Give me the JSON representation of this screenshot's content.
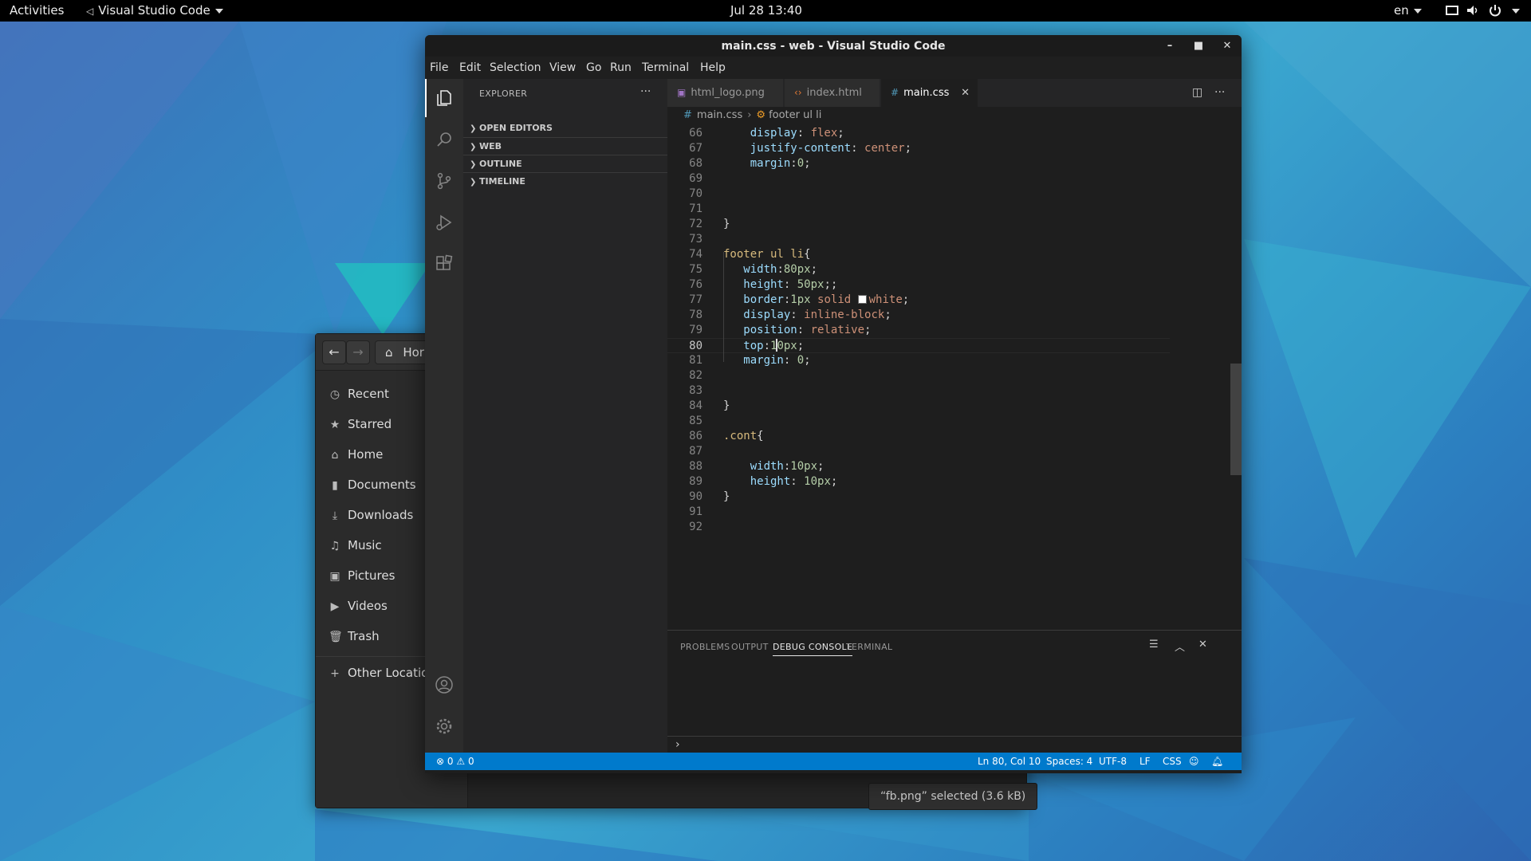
{
  "topbar": {
    "activities": "Activities",
    "app_name": "Visual Studio Code",
    "clock": "Jul 28  13:40",
    "lang": "en"
  },
  "files": {
    "path_label": "Hor",
    "sidebar": [
      {
        "label": "Recent",
        "icon": "clock-icon"
      },
      {
        "label": "Starred",
        "icon": "star-icon"
      },
      {
        "label": "Home",
        "icon": "home-icon"
      },
      {
        "label": "Documents",
        "icon": "document-icon"
      },
      {
        "label": "Downloads",
        "icon": "download-icon"
      },
      {
        "label": "Music",
        "icon": "music-icon"
      },
      {
        "label": "Pictures",
        "icon": "picture-icon"
      },
      {
        "label": "Videos",
        "icon": "video-icon"
      },
      {
        "label": "Trash",
        "icon": "trash-icon"
      },
      {
        "label": "Other Locations",
        "icon": "plus-icon"
      }
    ],
    "status": "“fb.png” selected (3.6 kB)"
  },
  "vscode": {
    "title": "main.css - web - Visual Studio Code",
    "menu": [
      "File",
      "Edit",
      "Selection",
      "View",
      "Go",
      "Run",
      "Terminal",
      "Help"
    ],
    "explorer": {
      "title": "EXPLORER",
      "sections": [
        "OPEN EDITORS",
        "WEB",
        "OUTLINE",
        "TIMELINE"
      ]
    },
    "tabs": [
      {
        "label": "html_logo.png",
        "icon": "image-icon"
      },
      {
        "label": "index.html",
        "icon": "html-icon"
      },
      {
        "label": "main.css",
        "icon": "css-icon",
        "active": true
      }
    ],
    "breadcrumb": {
      "file": "main.css",
      "symbol": "footer ul li"
    },
    "code_lines": [
      {
        "n": "66",
        "parts": [
          [
            "p",
            "    display"
          ],
          [
            "x",
            ": "
          ],
          [
            "v",
            "flex"
          ],
          [
            "x",
            ";"
          ]
        ]
      },
      {
        "n": "67",
        "parts": [
          [
            "p",
            "    justify-content"
          ],
          [
            "x",
            ": "
          ],
          [
            "v",
            "center"
          ],
          [
            "x",
            ";"
          ]
        ]
      },
      {
        "n": "68",
        "parts": [
          [
            "p",
            "    margin"
          ],
          [
            "x",
            ":"
          ],
          [
            "n",
            "0"
          ],
          [
            "x",
            ";"
          ]
        ]
      },
      {
        "n": "69",
        "parts": []
      },
      {
        "n": "70",
        "parts": []
      },
      {
        "n": "71",
        "parts": []
      },
      {
        "n": "72",
        "parts": [
          [
            "x",
            "}"
          ]
        ]
      },
      {
        "n": "73",
        "parts": []
      },
      {
        "n": "74",
        "parts": [
          [
            "s",
            "footer ul li"
          ],
          [
            "x",
            "{"
          ]
        ]
      },
      {
        "n": "75",
        "parts": [
          [
            "p",
            "   width"
          ],
          [
            "x",
            ":"
          ],
          [
            "n",
            "80px"
          ],
          [
            "x",
            ";"
          ]
        ]
      },
      {
        "n": "76",
        "parts": [
          [
            "p",
            "   height"
          ],
          [
            "x",
            ": "
          ],
          [
            "n",
            "50px"
          ],
          [
            "x",
            ";;"
          ]
        ]
      },
      {
        "n": "77",
        "parts": [
          [
            "p",
            "   border"
          ],
          [
            "x",
            ":"
          ],
          [
            "n",
            "1px"
          ],
          [
            "x",
            " "
          ],
          [
            "v",
            "solid "
          ],
          [
            "w",
            ""
          ],
          [
            "v",
            "white"
          ],
          [
            "x",
            ";"
          ]
        ]
      },
      {
        "n": "78",
        "parts": [
          [
            "p",
            "   display"
          ],
          [
            "x",
            ": "
          ],
          [
            "v",
            "inline-block"
          ],
          [
            "x",
            ";"
          ]
        ]
      },
      {
        "n": "79",
        "parts": [
          [
            "p",
            "   position"
          ],
          [
            "x",
            ": "
          ],
          [
            "v",
            "relative"
          ],
          [
            "x",
            ";"
          ]
        ]
      },
      {
        "n": "80",
        "parts": [
          [
            "p",
            "   top"
          ],
          [
            "x",
            ":"
          ],
          [
            "n",
            "10px"
          ],
          [
            "x",
            ";"
          ]
        ],
        "current": true
      },
      {
        "n": "81",
        "parts": [
          [
            "p",
            "   margin"
          ],
          [
            "x",
            ": "
          ],
          [
            "n",
            "0"
          ],
          [
            "x",
            ";"
          ]
        ]
      },
      {
        "n": "82",
        "parts": []
      },
      {
        "n": "83",
        "parts": []
      },
      {
        "n": "84",
        "parts": [
          [
            "x",
            "}"
          ]
        ]
      },
      {
        "n": "85",
        "parts": []
      },
      {
        "n": "86",
        "parts": [
          [
            "s",
            ".cont"
          ],
          [
            "x",
            "{"
          ]
        ]
      },
      {
        "n": "87",
        "parts": []
      },
      {
        "n": "88",
        "parts": [
          [
            "p",
            "    width"
          ],
          [
            "x",
            ":"
          ],
          [
            "n",
            "10px"
          ],
          [
            "x",
            ";"
          ]
        ]
      },
      {
        "n": "89",
        "parts": [
          [
            "p",
            "    height"
          ],
          [
            "x",
            ": "
          ],
          [
            "n",
            "10px"
          ],
          [
            "x",
            ";"
          ]
        ]
      },
      {
        "n": "90",
        "parts": [
          [
            "x",
            "}"
          ]
        ]
      },
      {
        "n": "91",
        "parts": []
      },
      {
        "n": "92",
        "parts": []
      }
    ],
    "panel_tabs": [
      "PROBLEMS",
      "OUTPUT",
      "DEBUG CONSOLE",
      "TERMINAL"
    ],
    "panel_active": "DEBUG CONSOLE",
    "prompt": "›",
    "status": {
      "errors": "0",
      "warnings": "0",
      "position": "Ln 80, Col 10",
      "spaces": "Spaces: 4",
      "encoding": "UTF-8",
      "eol": "LF",
      "language": "CSS"
    }
  },
  "colors": {
    "accent": "#007acc",
    "selector": "#d7ba7d",
    "property": "#9cdcfe",
    "value": "#ce9178",
    "number": "#b5cea8"
  }
}
